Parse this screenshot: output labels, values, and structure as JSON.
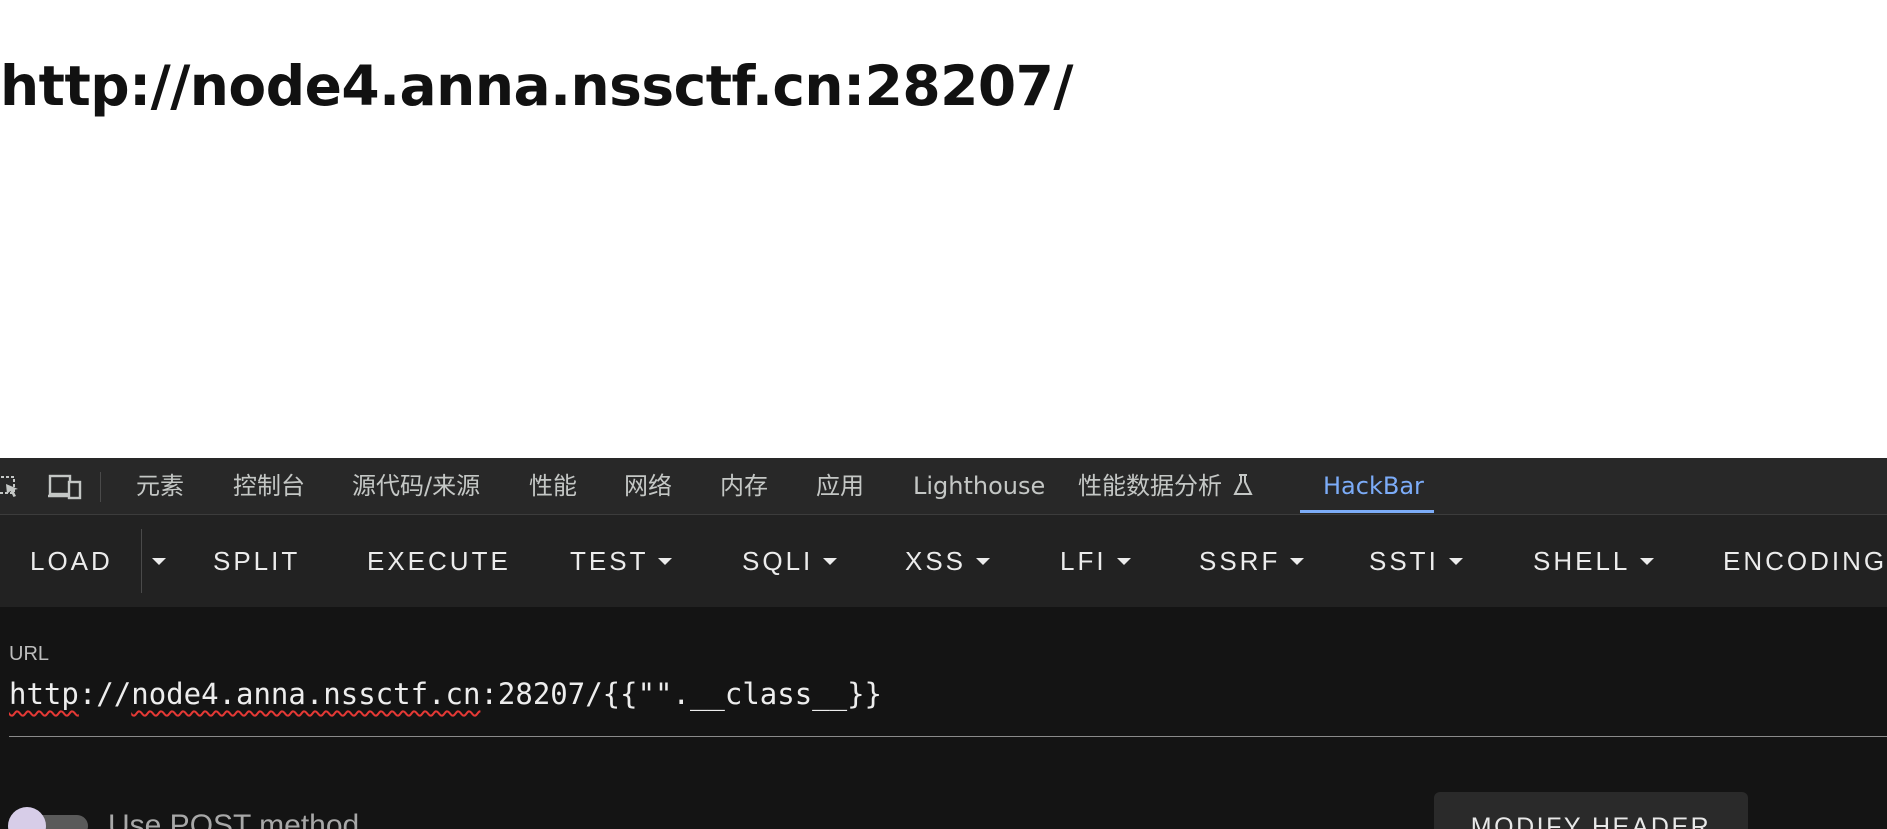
{
  "page": {
    "heading": "http://node4.anna.nssctf.cn:28207/"
  },
  "devtools": {
    "tabs": [
      {
        "label": "元素"
      },
      {
        "label": "控制台"
      },
      {
        "label": "源代码/来源"
      },
      {
        "label": "性能"
      },
      {
        "label": "网络"
      },
      {
        "label": "内存"
      },
      {
        "label": "应用"
      },
      {
        "label": "Lighthouse"
      },
      {
        "label": "性能数据分析"
      },
      {
        "label": "HackBar"
      }
    ],
    "active_tab": "HackBar"
  },
  "hackbar": {
    "toolbar": {
      "load": "LOAD",
      "split": "SPLIT",
      "execute": "EXECUTE",
      "test": "TEST",
      "sqli": "SQLI",
      "xss": "XSS",
      "lfi": "LFI",
      "ssrf": "SSRF",
      "ssti": "SSTI",
      "shell": "SHELL",
      "encoding": "ENCODING"
    },
    "url_label": "URL",
    "url_value": {
      "part1": "http",
      "part2": "://",
      "part3": "node4.anna.nssctf.cn",
      "part4": ":28207/{{\"\".__class__}}"
    },
    "post_toggle_label": "Use POST method",
    "post_enabled": false,
    "modify_header": "MODIFY HEADER"
  },
  "colors": {
    "active_tab": "#7cacf8",
    "devtools_bg": "#141414",
    "toolbar_bg": "#222222"
  }
}
